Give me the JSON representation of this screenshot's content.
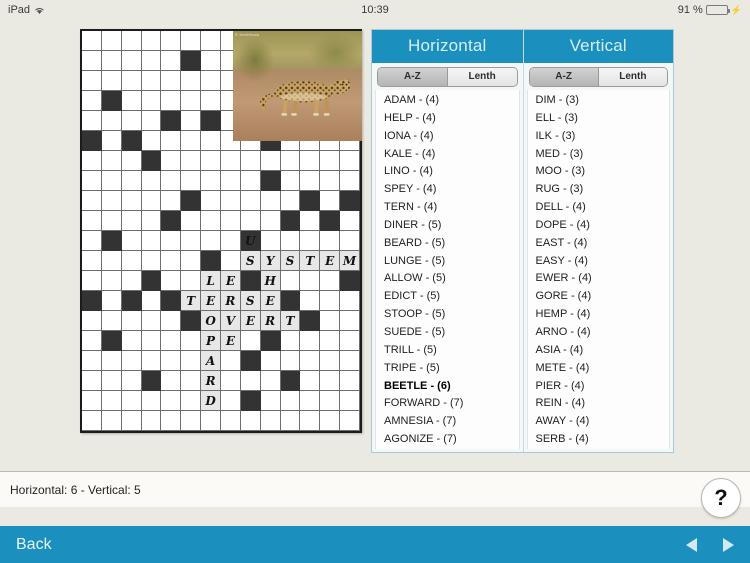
{
  "status_bar": {
    "device": "iPad",
    "wifi_icon": "wifi-icon",
    "time": "10:39",
    "battery_percent": "91 %",
    "battery_level": 91,
    "charging_icon": "lightning-bolt-icon"
  },
  "puzzle": {
    "photo_alt": "leopard-photo",
    "photo_credit": "© DevKitock",
    "columns": 14,
    "rows": 20,
    "black_cells": [
      [
        1,
        5
      ],
      [
        3,
        1
      ],
      [
        4,
        4
      ],
      [
        4,
        6
      ],
      [
        5,
        0
      ],
      [
        5,
        2
      ],
      [
        5,
        9
      ],
      [
        6,
        3
      ],
      [
        7,
        9
      ],
      [
        8,
        5
      ],
      [
        8,
        11
      ],
      [
        8,
        13
      ],
      [
        9,
        4
      ],
      [
        9,
        10
      ],
      [
        9,
        12
      ],
      [
        10,
        1
      ],
      [
        10,
        8
      ],
      [
        11,
        6
      ],
      [
        12,
        3
      ],
      [
        12,
        8
      ],
      [
        12,
        13
      ],
      [
        13,
        0
      ],
      [
        13,
        2
      ],
      [
        13,
        4
      ],
      [
        13,
        10
      ],
      [
        14,
        5
      ],
      [
        14,
        11
      ],
      [
        15,
        1
      ],
      [
        15,
        9
      ],
      [
        16,
        8
      ],
      [
        17,
        3
      ],
      [
        17,
        10
      ],
      [
        18,
        8
      ]
    ],
    "letters": [
      {
        "row": 11,
        "col": 9,
        "ch": "U"
      },
      {
        "row": 12,
        "col": 9,
        "ch": "S"
      },
      {
        "row": 12,
        "col": 10,
        "ch": "Y"
      },
      {
        "row": 12,
        "col": 11,
        "ch": "S"
      },
      {
        "row": 12,
        "col": 12,
        "ch": "T"
      },
      {
        "row": 12,
        "col": 13,
        "ch": "E"
      },
      {
        "row": 12,
        "col": 14,
        "ch": "M"
      },
      {
        "row": 13,
        "col": 7,
        "ch": "L"
      },
      {
        "row": 13,
        "col": 8,
        "ch": "E"
      },
      {
        "row": 13,
        "col": 10,
        "ch": "H"
      },
      {
        "row": 14,
        "col": 6,
        "ch": "T"
      },
      {
        "row": 14,
        "col": 7,
        "ch": "E"
      },
      {
        "row": 14,
        "col": 8,
        "ch": "R"
      },
      {
        "row": 14,
        "col": 9,
        "ch": "S"
      },
      {
        "row": 14,
        "col": 10,
        "ch": "E"
      },
      {
        "row": 15,
        "col": 7,
        "ch": "O"
      },
      {
        "row": 15,
        "col": 8,
        "ch": "V"
      },
      {
        "row": 15,
        "col": 9,
        "ch": "E"
      },
      {
        "row": 15,
        "col": 10,
        "ch": "R"
      },
      {
        "row": 15,
        "col": 11,
        "ch": "T"
      },
      {
        "row": 16,
        "col": 7,
        "ch": "P"
      },
      {
        "row": 16,
        "col": 8,
        "ch": "E"
      },
      {
        "row": 17,
        "col": 7,
        "ch": "A"
      },
      {
        "row": 18,
        "col": 7,
        "ch": "R"
      },
      {
        "row": 19,
        "col": 7,
        "ch": "D"
      }
    ]
  },
  "horizontal_panel": {
    "title": "Horizontal",
    "sort_az": "A-Z",
    "sort_length": "Lenth",
    "active_sort": "A-Z",
    "words": [
      {
        "word": "ADAM",
        "length": "(4)",
        "selected": false
      },
      {
        "word": "HELP",
        "length": "(4)",
        "selected": false
      },
      {
        "word": "IONA",
        "length": "(4)",
        "selected": false
      },
      {
        "word": "KALE",
        "length": "(4)",
        "selected": false
      },
      {
        "word": "LINO",
        "length": "(4)",
        "selected": false
      },
      {
        "word": "SPEY",
        "length": "(4)",
        "selected": false
      },
      {
        "word": "TERN",
        "length": "(4)",
        "selected": false
      },
      {
        "word": "DINER",
        "length": "(5)",
        "selected": false
      },
      {
        "word": "BEARD",
        "length": "(5)",
        "selected": false
      },
      {
        "word": "LUNGE",
        "length": "(5)",
        "selected": false
      },
      {
        "word": "ALLOW",
        "length": "(5)",
        "selected": false
      },
      {
        "word": "EDICT",
        "length": "(5)",
        "selected": false
      },
      {
        "word": "STOOP",
        "length": "(5)",
        "selected": false
      },
      {
        "word": "SUEDE",
        "length": "(5)",
        "selected": false
      },
      {
        "word": "TRILL",
        "length": "(5)",
        "selected": false
      },
      {
        "word": "TRIPE",
        "length": "(5)",
        "selected": false
      },
      {
        "word": "BEETLE",
        "length": "(6)",
        "selected": true
      },
      {
        "word": "FORWARD",
        "length": "(7)",
        "selected": false
      },
      {
        "word": "AMNESIA",
        "length": "(7)",
        "selected": false
      },
      {
        "word": "AGONIZE",
        "length": "(7)",
        "selected": false
      }
    ]
  },
  "vertical_panel": {
    "title": "Vertical",
    "sort_az": "A-Z",
    "sort_length": "Lenth",
    "active_sort": "A-Z",
    "words": [
      {
        "word": "DIM",
        "length": "(3)",
        "selected": false
      },
      {
        "word": "ELL",
        "length": "(3)",
        "selected": false
      },
      {
        "word": "ILK",
        "length": "(3)",
        "selected": false
      },
      {
        "word": "MED",
        "length": "(3)",
        "selected": false
      },
      {
        "word": "MOO",
        "length": "(3)",
        "selected": false
      },
      {
        "word": "RUG",
        "length": "(3)",
        "selected": false
      },
      {
        "word": "DELL",
        "length": "(4)",
        "selected": false
      },
      {
        "word": "DOPE",
        "length": "(4)",
        "selected": false
      },
      {
        "word": "EAST",
        "length": "(4)",
        "selected": false
      },
      {
        "word": "EASY",
        "length": "(4)",
        "selected": false
      },
      {
        "word": "EWER",
        "length": "(4)",
        "selected": false
      },
      {
        "word": "GORE",
        "length": "(4)",
        "selected": false
      },
      {
        "word": "HEMP",
        "length": "(4)",
        "selected": false
      },
      {
        "word": "ARNO",
        "length": "(4)",
        "selected": false
      },
      {
        "word": "ASIA",
        "length": "(4)",
        "selected": false
      },
      {
        "word": "METE",
        "length": "(4)",
        "selected": false
      },
      {
        "word": "PIER",
        "length": "(4)",
        "selected": false
      },
      {
        "word": "REIN",
        "length": "(4)",
        "selected": false
      },
      {
        "word": "AWAY",
        "length": "(4)",
        "selected": false
      },
      {
        "word": "SERB",
        "length": "(4)",
        "selected": false
      }
    ]
  },
  "info_bar": {
    "counts_text": "Horizontal: 6 - Vertical: 5",
    "help_label": "?"
  },
  "nav_bar": {
    "back_label": "Back",
    "prev_icon": "left-triangle-icon",
    "next_icon": "right-triangle-icon"
  },
  "colors": {
    "accent": "#1b8fbd",
    "page_bg": "#ebeae2",
    "black_cell": "#333333",
    "filled_cell": "#e7e7e7",
    "battery_green": "#4cd964"
  }
}
